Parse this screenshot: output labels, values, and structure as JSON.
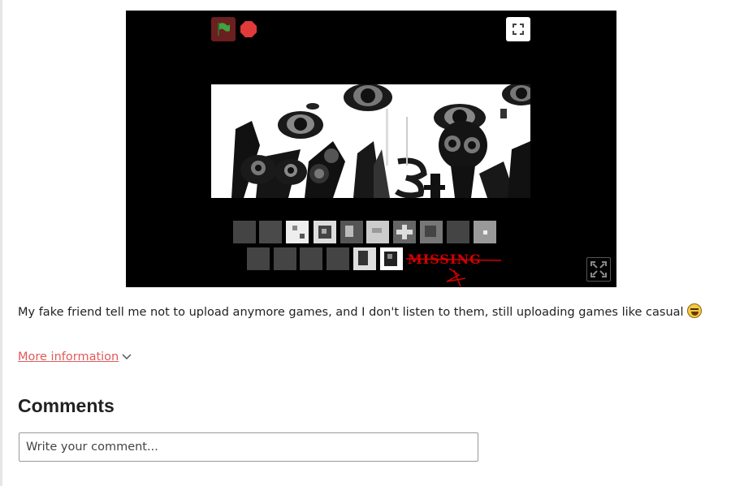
{
  "player": {
    "controls": {
      "green_flag": "green-flag-icon",
      "stop": "stop-icon",
      "fullscreen_top": "fullscreen-icon",
      "fullscreen_bottom": "fullscreen-icon"
    },
    "overlay_text": "MISSING",
    "colors": {
      "background": "#000000",
      "flag_button_bg": "#6b1f1f",
      "flag": "#3fa33f",
      "stop": "#e03a3a",
      "missing_text": "#d40000"
    }
  },
  "description": {
    "text": "My fake friend tell me not to upload anymore games, and I don't listen to them, still uploading games like casual",
    "emoji": "laughing-emoji"
  },
  "more_information": {
    "label": "More information"
  },
  "comments": {
    "title": "Comments",
    "input_placeholder": "Write your comment..."
  }
}
